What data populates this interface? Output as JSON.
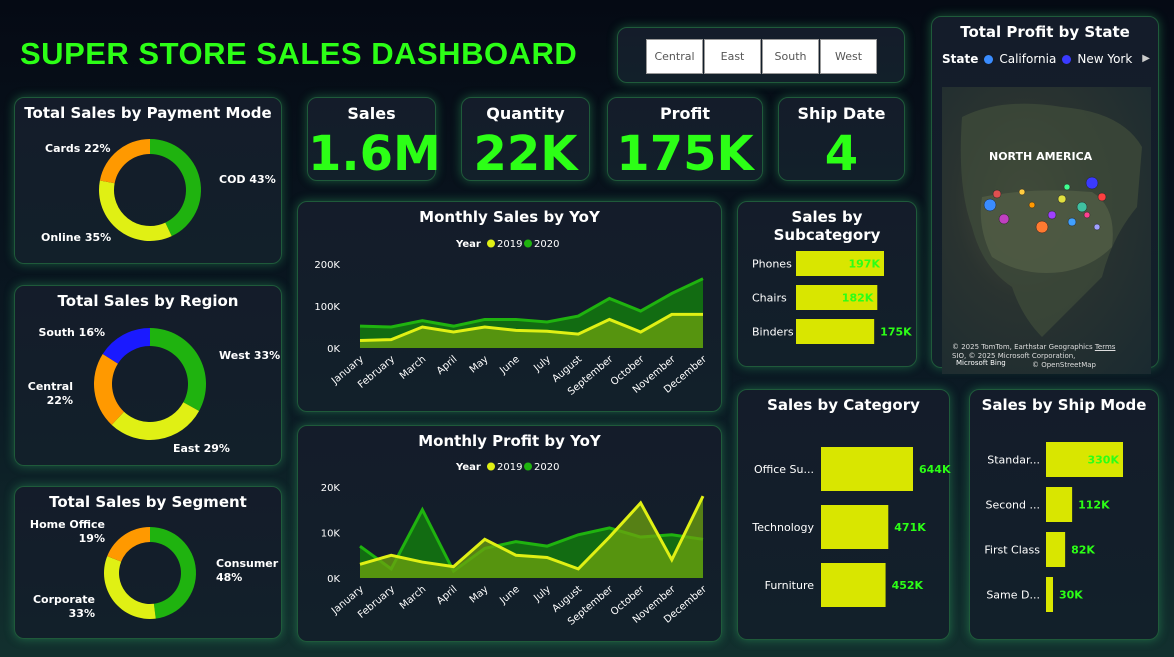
{
  "title": "SUPER STORE SALES DASHBOARD",
  "slicer": {
    "options": [
      "Central",
      "East",
      "South",
      "West"
    ]
  },
  "kpis": [
    {
      "label": "Sales",
      "value": "1.6M"
    },
    {
      "label": "Quantity",
      "value": "22K"
    },
    {
      "label": "Profit",
      "value": "175K"
    },
    {
      "label": "Ship Date",
      "value": "4"
    }
  ],
  "colors": {
    "accent": "#2cff16",
    "green": "#1fb30f",
    "yellow": "#e0f014",
    "orange": "#ff9900",
    "blue": "#1a1aff",
    "bar": "#d9e600"
  },
  "map": {
    "title": "Total Profit by State",
    "legend_title": "State",
    "legend_items": [
      {
        "name": "California",
        "color": "#3a8cff"
      },
      {
        "name": "New York",
        "color": "#3a3aff"
      }
    ],
    "region_label": "NORTH AMERICA",
    "attribution_1": "© 2025 TomTom, Earthstar Geographics",
    "attribution_terms": "Terms",
    "attribution_2": "SIO, © 2025 Microsoft Corporation,",
    "attribution_3": "© OpenStreetMap",
    "bing": "Microsoft Bing"
  },
  "chart_data": [
    {
      "id": "payment",
      "type": "pie",
      "title": "Total Sales by Payment Mode",
      "slices": [
        {
          "name": "COD",
          "value": 43,
          "label": "COD 43%",
          "color": "#1fb30f"
        },
        {
          "name": "Online",
          "value": 35,
          "label": "Online 35%",
          "color": "#e0f014"
        },
        {
          "name": "Cards",
          "value": 22,
          "label": "Cards 22%",
          "color": "#ff9900"
        }
      ]
    },
    {
      "id": "region",
      "type": "pie",
      "title": "Total Sales by Region",
      "slices": [
        {
          "name": "West",
          "value": 33,
          "label": "West 33%",
          "color": "#1fb30f"
        },
        {
          "name": "East",
          "value": 29,
          "label": "East 29%",
          "color": "#e0f014"
        },
        {
          "name": "Central",
          "value": 22,
          "label": "Central 22%",
          "color": "#ff9900"
        },
        {
          "name": "South",
          "value": 16,
          "label": "South 16%",
          "color": "#1a1aff"
        }
      ]
    },
    {
      "id": "segment",
      "type": "pie",
      "title": "Total Sales by Segment",
      "slices": [
        {
          "name": "Consumer",
          "value": 48,
          "label": "Consumer 48%",
          "color": "#1fb30f"
        },
        {
          "name": "Corporate",
          "value": 33,
          "label": "Corporate 33%",
          "color": "#e0f014"
        },
        {
          "name": "Home Office",
          "value": 19,
          "label": "Home Office 19%",
          "color": "#ff9900"
        }
      ]
    },
    {
      "id": "monthly_sales",
      "type": "area",
      "title": "Monthly Sales by YoY",
      "legend_title": "Year",
      "categories": [
        "January",
        "February",
        "March",
        "April",
        "May",
        "June",
        "July",
        "August",
        "September",
        "October",
        "November",
        "December"
      ],
      "yticks": [
        "0K",
        "100K",
        "200K"
      ],
      "ylim": [
        0,
        200000
      ],
      "series": [
        {
          "name": "2019",
          "color": "#e0f014",
          "values": [
            18000,
            20000,
            50000,
            38000,
            50000,
            42000,
            40000,
            33000,
            68000,
            38000,
            80000,
            80000
          ]
        },
        {
          "name": "2020",
          "color": "#1fb30f",
          "values": [
            52000,
            50000,
            65000,
            52000,
            68000,
            68000,
            62000,
            76000,
            118000,
            88000,
            130000,
            165000
          ]
        }
      ]
    },
    {
      "id": "monthly_profit",
      "type": "area",
      "title": "Monthly Profit by YoY",
      "legend_title": "Year",
      "categories": [
        "January",
        "February",
        "March",
        "April",
        "May",
        "June",
        "July",
        "August",
        "September",
        "October",
        "November",
        "December"
      ],
      "yticks": [
        "0K",
        "10K",
        "20K"
      ],
      "ylim": [
        0,
        20000
      ],
      "series": [
        {
          "name": "2019",
          "color": "#e0f014",
          "values": [
            3000,
            5000,
            3500,
            2500,
            8500,
            5000,
            4500,
            2000,
            9000,
            16500,
            4000,
            18000
          ]
        },
        {
          "name": "2020",
          "color": "#1fb30f",
          "values": [
            7000,
            2000,
            15000,
            1500,
            6500,
            8000,
            7000,
            9500,
            11000,
            9000,
            9500,
            8500
          ]
        }
      ]
    },
    {
      "id": "subcategory",
      "type": "bar",
      "title": "Sales by Subcategory",
      "categories": [
        "Phones",
        "Chairs",
        "Binders"
      ],
      "values": [
        197,
        182,
        175
      ],
      "labels": [
        "197K",
        "182K",
        "175K"
      ]
    },
    {
      "id": "category",
      "type": "bar",
      "title": "Sales by Category",
      "categories": [
        "Office Su...",
        "Technology",
        "Furniture"
      ],
      "values": [
        644,
        471,
        452
      ],
      "labels": [
        "644K",
        "471K",
        "452K"
      ]
    },
    {
      "id": "shipmode",
      "type": "bar",
      "title": "Sales by Ship Mode",
      "categories": [
        "Standar...",
        "Second ...",
        "First Class",
        "Same D..."
      ],
      "values": [
        330,
        112,
        82,
        30
      ],
      "labels": [
        "330K",
        "112K",
        "82K",
        "30K"
      ]
    }
  ]
}
